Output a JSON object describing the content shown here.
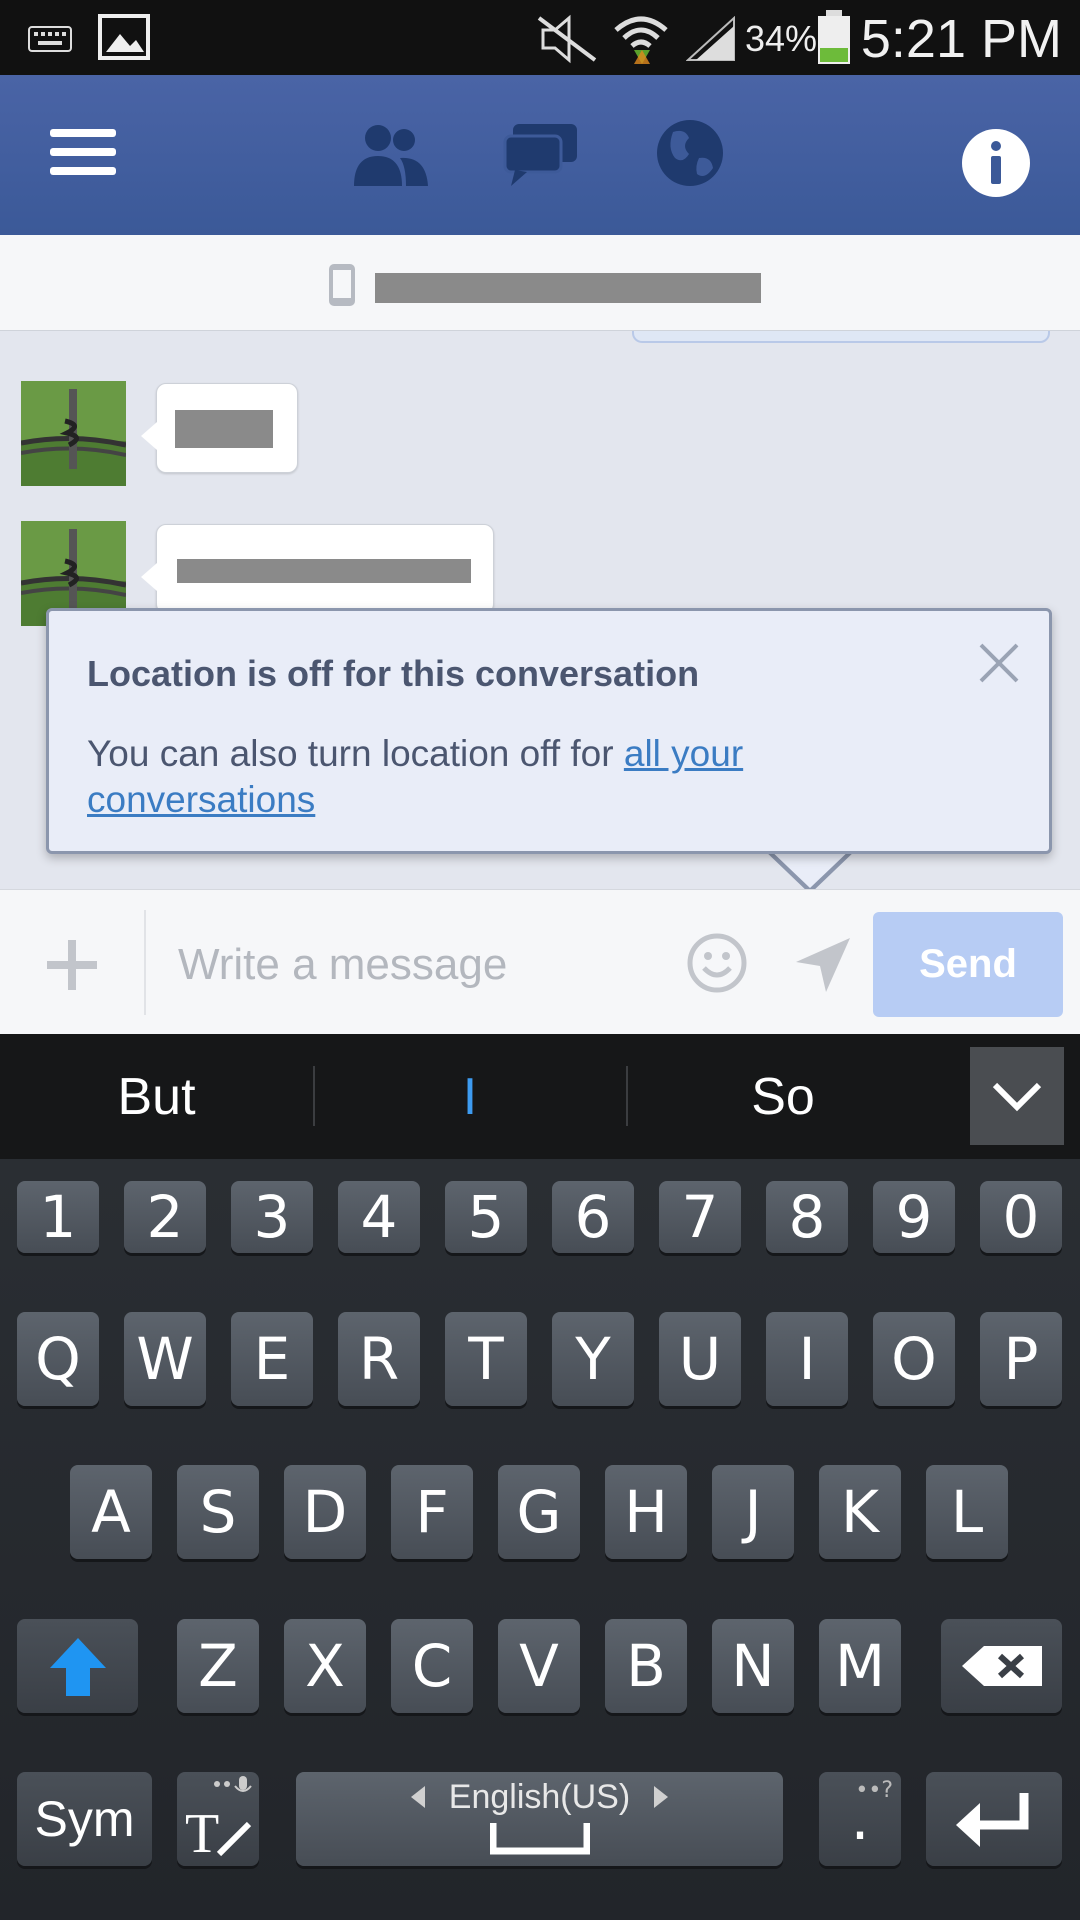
{
  "status_bar": {
    "battery_percent": "34%",
    "time": "5:21 PM",
    "icons": [
      "keyboard-icon",
      "image-icon",
      "mute-icon",
      "wifi-icon",
      "signal-icon",
      "battery-icon"
    ]
  },
  "header": {
    "icons": [
      "menu-icon",
      "friends-icon",
      "messages-icon",
      "globe-icon",
      "info-icon"
    ],
    "accent": "#3b5998"
  },
  "conversation": {
    "participant_icon": "phone-icon"
  },
  "popup": {
    "title": "Location is off for this conversation",
    "body_prefix": "You can also turn location off for ",
    "link_text": "all your conversations"
  },
  "composer": {
    "placeholder": "Write a message",
    "send_label": "Send",
    "icons": [
      "add-icon",
      "emoji-icon",
      "location-arrow-icon"
    ]
  },
  "suggestions": [
    "But",
    "I",
    "So"
  ],
  "keyboard": {
    "row_numbers": [
      "1",
      "2",
      "3",
      "4",
      "5",
      "6",
      "7",
      "8",
      "9",
      "0"
    ],
    "row_1": [
      "Q",
      "W",
      "E",
      "R",
      "T",
      "Y",
      "U",
      "I",
      "O",
      "P"
    ],
    "row_2": [
      "A",
      "S",
      "D",
      "F",
      "G",
      "H",
      "J",
      "K",
      "L"
    ],
    "row_3": [
      "Z",
      "X",
      "C",
      "V",
      "B",
      "N",
      "M"
    ],
    "sym_label": "Sym",
    "language_label": "English(US)",
    "period_label": "."
  }
}
